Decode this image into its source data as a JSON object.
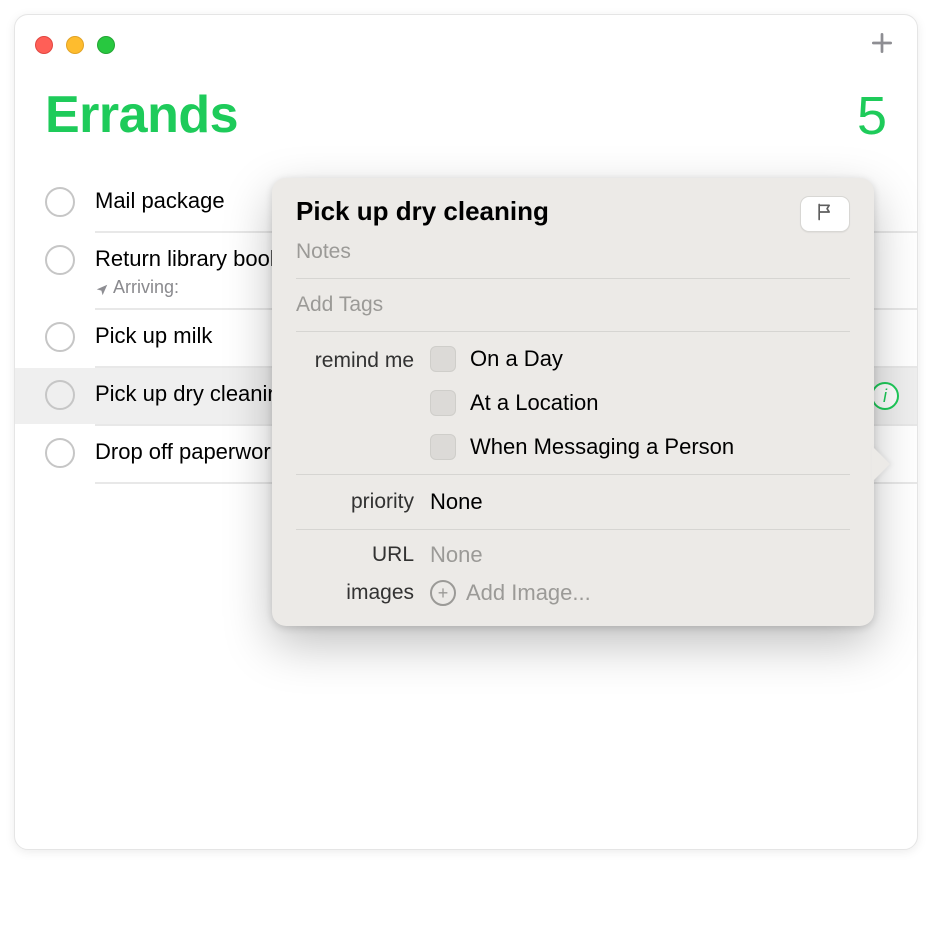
{
  "header": {
    "title": "Errands",
    "count": "5"
  },
  "reminders": [
    {
      "title": "Mail package",
      "sub": ""
    },
    {
      "title": "Return library books",
      "sub": "Arriving:"
    },
    {
      "title": "Pick up milk",
      "sub": ""
    },
    {
      "title": "Pick up dry cleaning",
      "sub": ""
    },
    {
      "title": "Drop off paperwork",
      "sub": ""
    }
  ],
  "popover": {
    "title": "Pick up dry cleaning",
    "notes_placeholder": "Notes",
    "add_tags": "Add Tags",
    "remind_label": "remind me",
    "remind_options": {
      "day": "On a Day",
      "location": "At a Location",
      "messaging": "When Messaging a Person"
    },
    "priority_label": "priority",
    "priority_value": "None",
    "url_label": "URL",
    "url_value": "None",
    "images_label": "images",
    "add_image": "Add Image..."
  },
  "info_glyph": "i"
}
